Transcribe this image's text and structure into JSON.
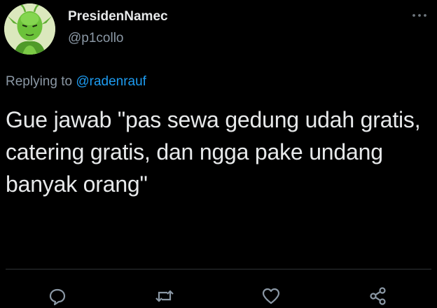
{
  "tweet": {
    "author": {
      "display_name": "PresidenNamec",
      "handle": "@p1collo",
      "avatar_icon": "green-character-avatar"
    },
    "more_icon": "more-horizontal-icon",
    "reply_prefix": "Replying to",
    "reply_mention": "@radenrauf",
    "text": "Gue jawab \"pas sewa gedung udah gratis, catering gratis, dan ngga pake undang banyak orang\"",
    "actions": [
      {
        "name": "reply",
        "icon": "comment-icon"
      },
      {
        "name": "retweet",
        "icon": "retweet-icon"
      },
      {
        "name": "like",
        "icon": "heart-icon"
      },
      {
        "name": "share",
        "icon": "share-icon"
      }
    ]
  },
  "colors": {
    "background": "#000000",
    "text": "#e7e9ea",
    "secondary_text": "#8b98a5",
    "accent": "#1d9bf0",
    "divider": "#2f3336"
  }
}
